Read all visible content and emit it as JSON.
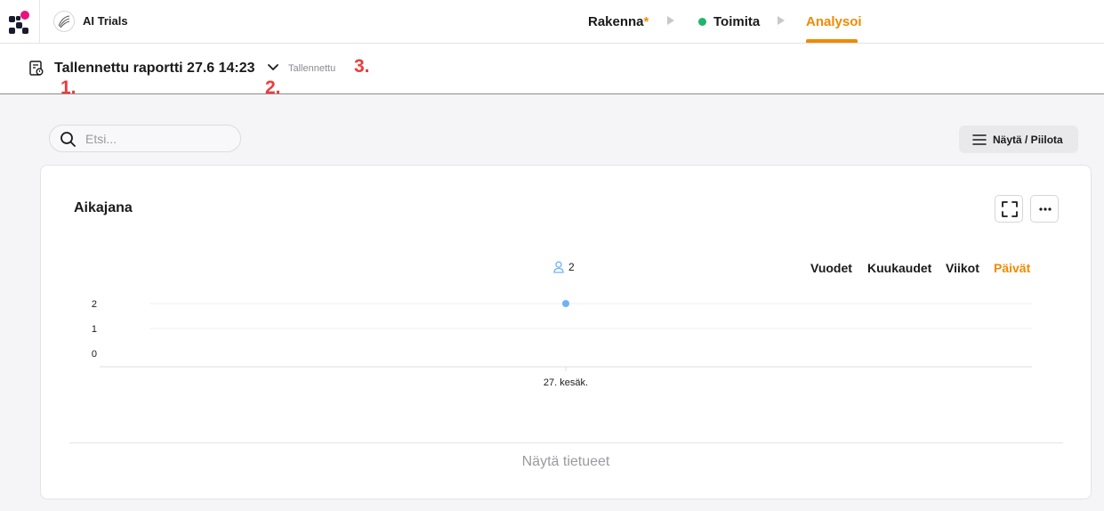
{
  "app": {
    "name": "AI Trials"
  },
  "steps": [
    {
      "label": "Rakenna",
      "modified": "*"
    },
    {
      "label": "Toimita"
    },
    {
      "label": "Analysoi"
    }
  ],
  "report": {
    "title": "Tallennettu raportti 27.6 14:23",
    "status": "Tallennettu",
    "markers": [
      "1.",
      "2.",
      "3."
    ]
  },
  "search": {
    "placeholder": "Etsi..."
  },
  "toolbar": {
    "toggle_label": "Näytä / Piilota"
  },
  "timeline": {
    "title": "Aikajana",
    "ranges": [
      "Vuodet",
      "Kuukaudet",
      "Viikot",
      "Päivät"
    ],
    "active_range": "Päivät",
    "show_records": "Näytä tietueet"
  },
  "colors": {
    "accent": "#f08a00",
    "point": "#6fb3f5",
    "live": "#1fb56b",
    "marker": "#ee3b3b"
  },
  "chart_data": {
    "type": "scatter",
    "x": [
      "27. kesäk."
    ],
    "series": [
      {
        "values": [
          2
        ]
      }
    ],
    "legend_count": "2",
    "yticks": [
      "0",
      "1",
      "2"
    ],
    "ylim": [
      0,
      2
    ],
    "grid": true,
    "title": "Aikajana",
    "xlabel": "",
    "ylabel": ""
  }
}
